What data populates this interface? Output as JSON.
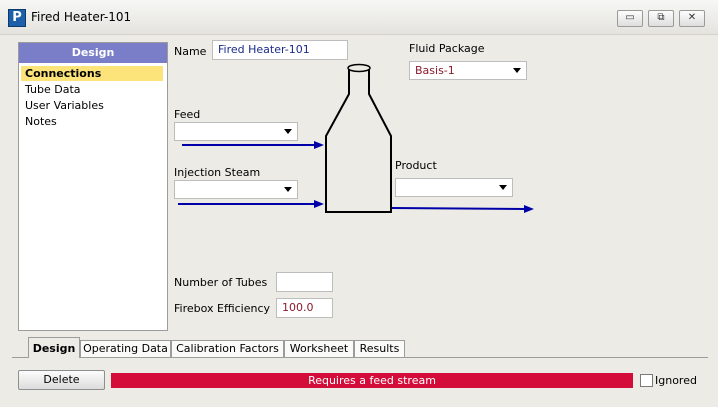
{
  "window": {
    "title": "Fired Heater-101",
    "minimize": "▭",
    "restore": "⧉",
    "close": "✕"
  },
  "nav": {
    "header": "Design",
    "items": [
      "Connections",
      "Tube Data",
      "User Variables",
      "Notes"
    ],
    "active": "Connections"
  },
  "form": {
    "name_label": "Name",
    "name_value": "Fired Heater-101",
    "fluid_package_label": "Fluid Package",
    "fluid_package_value": "Basis-1",
    "feed_label": "Feed",
    "feed_value": "",
    "injection_steam_label": "Injection Steam",
    "injection_steam_value": "",
    "product_label": "Product",
    "product_value": "",
    "num_tubes_label": "Number of Tubes",
    "num_tubes_value": "",
    "firebox_eff_label": "Firebox Efficiency",
    "firebox_eff_value": "100.0"
  },
  "tabs": [
    "Design",
    "Operating Data",
    "Calibration Factors",
    "Worksheet",
    "Results"
  ],
  "active_tab": "Design",
  "footer": {
    "delete_label": "Delete",
    "status_text": "Requires a feed stream",
    "ignored_label": "Ignored",
    "ignored_checked": false
  },
  "colors": {
    "status": "#d40c3a",
    "stream": "#0000a8",
    "nav_header": "#7a7ec8",
    "nav_active": "#fde47a"
  }
}
